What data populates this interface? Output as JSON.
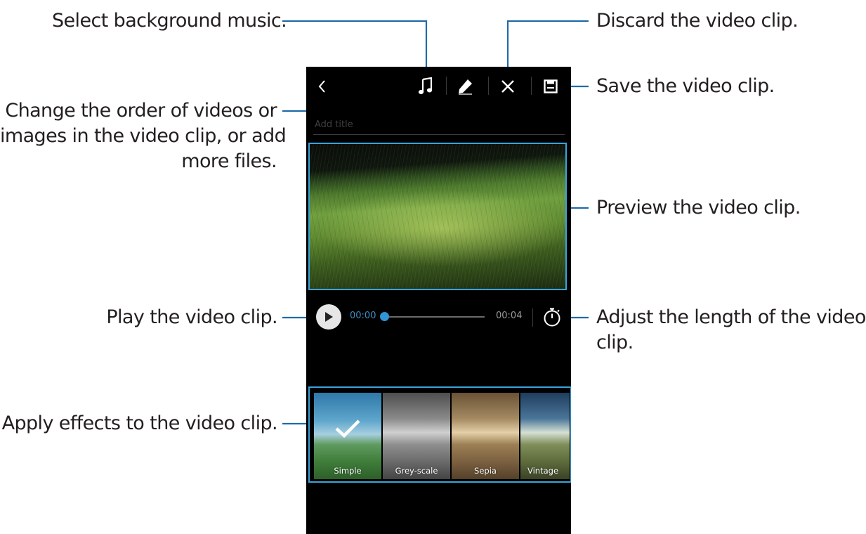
{
  "callouts": {
    "select_music": "Select background music.",
    "change_order_1": "Change the order of videos or",
    "change_order_2": "images in the video clip, or add",
    "change_order_3": "more files.",
    "play_clip": "Play the video clip.",
    "apply_effects": "Apply effects to the video clip.",
    "discard_clip": "Discard the video clip.",
    "save_clip": "Save the video clip.",
    "preview_clip": "Preview the video clip.",
    "adjust_length_1": "Adjust the length of the video",
    "adjust_length_2": "clip."
  },
  "editor": {
    "title_placeholder": "Add title",
    "time_current": "00:00",
    "time_total": "00:04",
    "playback_progress": 0.0,
    "effects": [
      {
        "label": "Simple",
        "selected": true
      },
      {
        "label": "Grey-scale",
        "selected": false
      },
      {
        "label": "Sepia",
        "selected": false
      },
      {
        "label": "Vintage",
        "selected": false
      }
    ]
  },
  "icons": {
    "back": "chevron-left-icon",
    "music": "music-note-icon",
    "edit": "pencil-icon",
    "discard": "close-icon",
    "save": "save-icon",
    "play": "play-icon",
    "length": "timer-icon",
    "selected": "checkmark-icon"
  },
  "colors": {
    "callout_text": "#231f20",
    "callout_line": "#1f6aa8",
    "highlight_border": "#3aa3dc",
    "progress_accent": "#2f95d6",
    "screen_background": "#000000"
  }
}
